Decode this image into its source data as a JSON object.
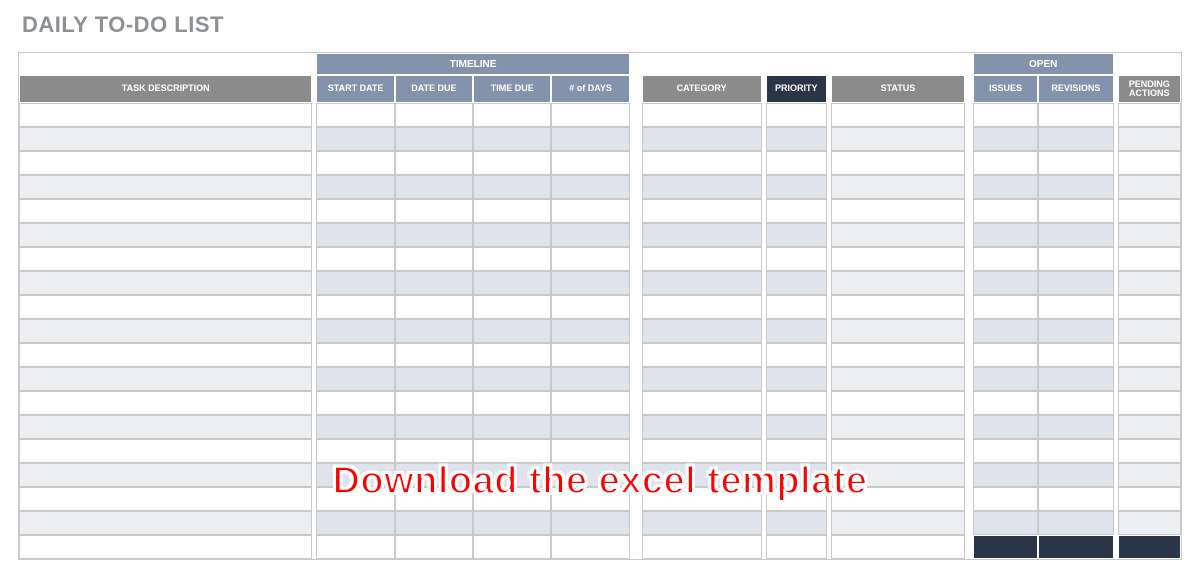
{
  "title": "DAILY TO-DO LIST",
  "groups": {
    "timeline": "TIMELINE",
    "open": "OPEN"
  },
  "headers": {
    "desc": "TASK DESCRIPTION",
    "start": "START DATE",
    "due": "DATE DUE",
    "time": "TIME DUE",
    "days": "# of DAYS",
    "cat": "CATEGORY",
    "prio": "PRIORITY",
    "stat": "STATUS",
    "issues": "ISSUES",
    "rev": "REVISIONS",
    "pend": "PENDING ACTIONS"
  },
  "row_count": 18,
  "overlay": "Download the excel template",
  "colors": {
    "title_gray": "#8d9194",
    "header_gray": "#8b8b8b",
    "header_blue": "#8393ab",
    "header_dark": "#2a3648",
    "band_light": "#edeff2",
    "band_timeline_light": "#dfe3eb",
    "overlay_red": "#ff0000"
  }
}
